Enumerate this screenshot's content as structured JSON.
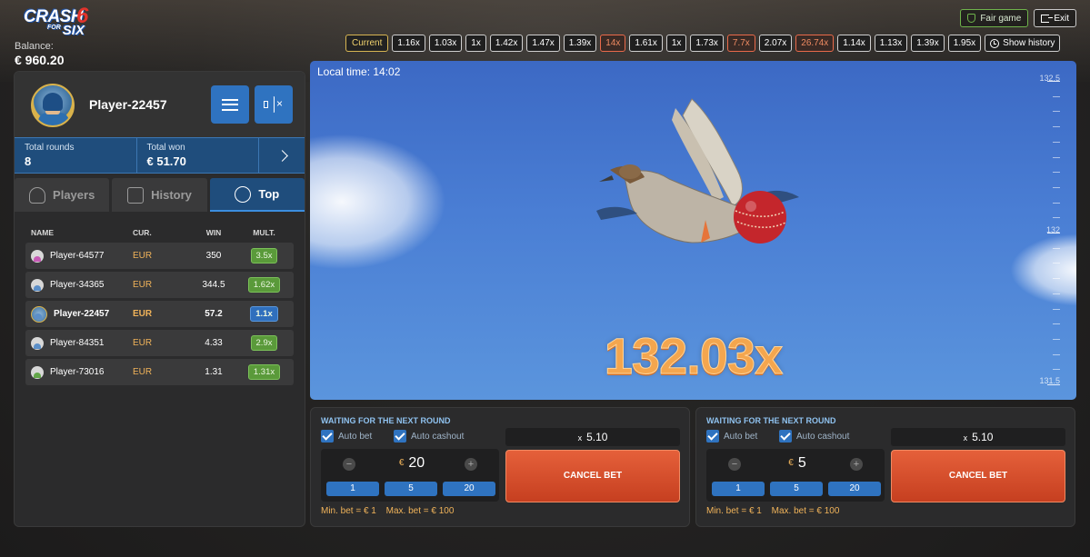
{
  "header": {
    "logo": {
      "line1": "CRASH",
      "for": "FOR",
      "line2": "SIX",
      "mark": "6"
    },
    "balance_label": "Balance:",
    "balance_value": "€ 960.20",
    "fair_game": "Fair game",
    "exit": "Exit"
  },
  "history": {
    "current": "Current",
    "chips": [
      "1.16x",
      "1.03x",
      "1x",
      "1.42x",
      "1.47x",
      "1.39x",
      "14x",
      "1.61x",
      "1x",
      "1.73x",
      "7.7x",
      "2.07x",
      "26.74x",
      "1.14x",
      "1.13x",
      "1.39x",
      "1.95x"
    ],
    "hot_indices": [
      6,
      10,
      12
    ],
    "show_history": "Show history"
  },
  "profile": {
    "name": "Player-22457",
    "total_rounds_label": "Total rounds",
    "total_rounds": "8",
    "total_won_label": "Total won",
    "total_won": "€ 51.70"
  },
  "tabs": [
    {
      "label": "Players",
      "icon": "players-icon"
    },
    {
      "label": "History",
      "icon": "calendar-icon"
    },
    {
      "label": "Top",
      "icon": "medal-icon"
    }
  ],
  "table": {
    "headers": {
      "name": "NAME",
      "cur": "CUR.",
      "win": "WIN",
      "mult": "MULT."
    },
    "rows": [
      {
        "name": "Player-64577",
        "cur": "EUR",
        "win": "350",
        "mult": "3.5x",
        "avatar": "pink",
        "me": false
      },
      {
        "name": "Player-34365",
        "cur": "EUR",
        "win": "344.5",
        "mult": "1.62x",
        "avatar": "blue",
        "me": false
      },
      {
        "name": "Player-22457",
        "cur": "EUR",
        "win": "57.2",
        "mult": "1.1x",
        "avatar": "me",
        "me": true
      },
      {
        "name": "Player-84351",
        "cur": "EUR",
        "win": "4.33",
        "mult": "2.9x",
        "avatar": "blue",
        "me": false
      },
      {
        "name": "Player-73016",
        "cur": "EUR",
        "win": "1.31",
        "mult": "1.31x",
        "avatar": "green",
        "me": false
      }
    ]
  },
  "game": {
    "local_time": "Local time: 14:02",
    "multiplier": "132.03x",
    "scale_labels": [
      "132.5",
      "132",
      "131.5"
    ]
  },
  "bets": [
    {
      "status": "WAITING FOR THE NEXT ROUND",
      "auto_bet": "Auto bet",
      "auto_cashout": "Auto cashout",
      "currency": "€",
      "amount": "20",
      "cashout_prefix": "x",
      "cashout": "5.10",
      "quick": [
        "1",
        "5",
        "20"
      ],
      "action": "CANCEL BET",
      "min": "Min. bet = € 1",
      "max": "Max. bet = € 100"
    },
    {
      "status": "WAITING FOR THE NEXT ROUND",
      "auto_bet": "Auto bet",
      "auto_cashout": "Auto cashout",
      "currency": "€",
      "amount": "5",
      "cashout_prefix": "x",
      "cashout": "5.10",
      "quick": [
        "1",
        "5",
        "20"
      ],
      "action": "CANCEL BET",
      "min": "Min. bet = € 1",
      "max": "Max. bet = € 100"
    }
  ],
  "colors": {
    "accent": "#2f73c0",
    "gold": "#f0b35a",
    "cancel": "#d54a28",
    "win_green": "#5a9a3a"
  }
}
